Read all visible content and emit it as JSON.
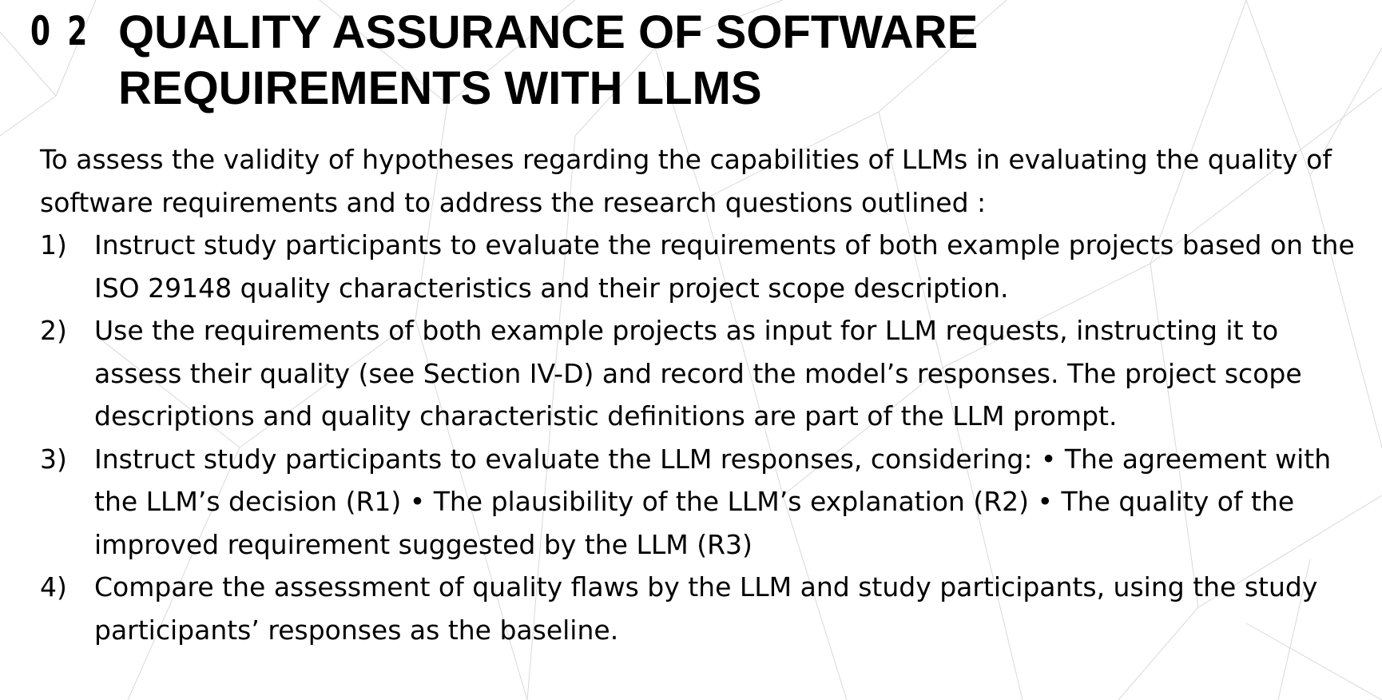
{
  "slide": {
    "section_number": "0 2",
    "title": "QUALITY ASSURANCE OF SOFTWARE\nREQUIREMENTS  WITH LLMS",
    "intro": "To assess the validity of hypotheses regarding the capabilities of LLMs in evaluating the quality of software requirements and to address the research questions outlined :",
    "steps": [
      {
        "number": "1)",
        "text": "Instruct study participants to evaluate the requirements of both example projects based on the ISO 29148 quality characteristics and their project scope description."
      },
      {
        "number": "2)",
        "text": "Use the requirements of both example projects as input for LLM requests, instructing it to assess their quality (see Section IV-D) and record the model’s responses. The project scope descriptions and quality characteristic definitions are part of the LLM prompt."
      },
      {
        "number": "3)",
        "text": "Instruct study participants to evaluate the LLM responses, considering: • The agreement with the LLM’s decision (R1) • The plausibility of the LLM’s explanation (R2) • The quality of the improved requirement suggested by the LLM (R3)"
      },
      {
        "number": "4)",
        "text": "Compare the assessment of quality flaws by the LLM and study participants, using the study participants’ responses as the baseline."
      }
    ]
  },
  "colors": {
    "text": "#000000",
    "background": "#ffffff",
    "decorative_lines": "#d9d9d9"
  }
}
